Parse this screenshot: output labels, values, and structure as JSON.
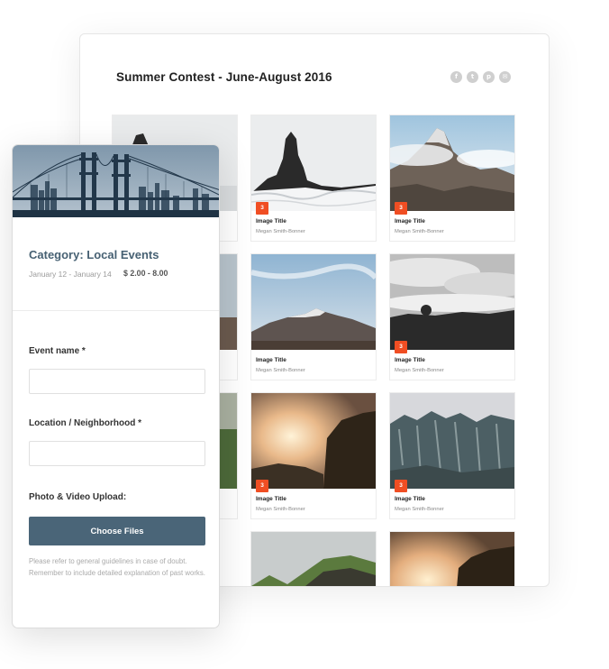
{
  "gallery": {
    "title": "Summer Contest - June-August 2016",
    "social_icons": [
      {
        "icon": "facebook-icon",
        "glyph": "f"
      },
      {
        "icon": "twitter-icon",
        "glyph": "t"
      },
      {
        "icon": "pinterest-icon",
        "glyph": "p"
      },
      {
        "icon": "mail-icon",
        "glyph": "✉"
      }
    ],
    "cards": [
      {
        "title": "Image Title",
        "author": "Megan Smith-Bonner",
        "badge": "3"
      },
      {
        "title": "Image Title",
        "author": "Megan Smith-Bonner",
        "badge": "3"
      },
      {
        "title": "Image Title",
        "author": "Megan Smith-Bonner",
        "badge": "3"
      },
      {
        "title": "Image Title",
        "author": "Megan Smith-Bonner",
        "badge": "3"
      },
      {
        "title": "Image Title",
        "author": "Megan Smith-Bonner",
        "badge": "3"
      },
      {
        "title": "Image Title",
        "author": "Megan Smith-Bonner",
        "badge": "3"
      }
    ]
  },
  "form": {
    "category": "Category: Local Events",
    "dates": "January 12 - January 14",
    "price": "$ 2.00 - 8.00",
    "event_name_label": "Event name *",
    "event_name_value": "",
    "location_label": "Location / Neighborhood *",
    "location_value": "",
    "upload_label": "Photo & Video Upload:",
    "choose_files": "Choose Files",
    "help_text": "Please refer to general guidelines in case of doubt. Remember to include detailed explanation of past works."
  },
  "colors": {
    "accent": "#476173",
    "button": "#4a6578",
    "badge": "#f04e23"
  }
}
